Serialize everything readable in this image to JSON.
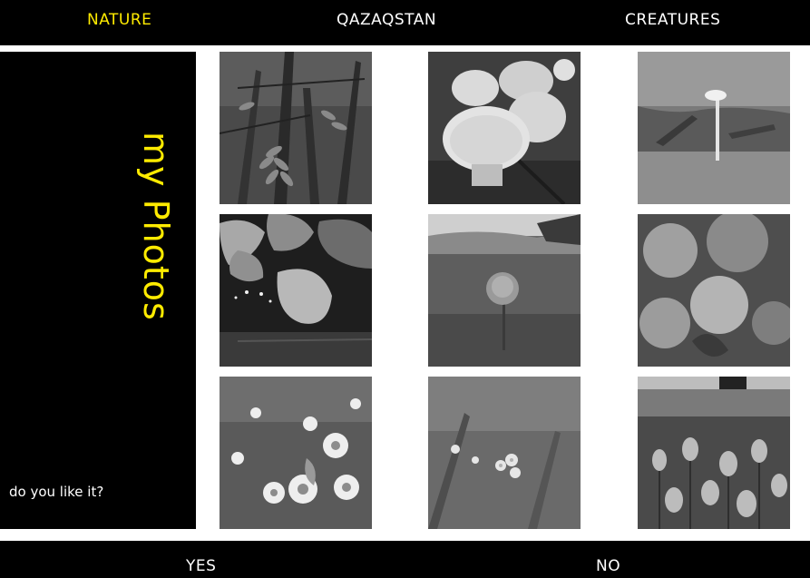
{
  "nav": {
    "items": [
      {
        "label": "NATURE",
        "active": true
      },
      {
        "label": "QAZAQSTAN",
        "active": false
      },
      {
        "label": "CREATURES",
        "active": false
      }
    ]
  },
  "sidebar": {
    "title": "my Photos",
    "question": "do you like it?"
  },
  "gallery": {
    "photos": [
      {
        "subject": "rowan-tree"
      },
      {
        "subject": "puffball-mushrooms"
      },
      {
        "subject": "small-mushroom"
      },
      {
        "subject": "linden-leaves"
      },
      {
        "subject": "globeflower-meadow"
      },
      {
        "subject": "hydrangea"
      },
      {
        "subject": "daisies"
      },
      {
        "subject": "forget-me-nots"
      },
      {
        "subject": "tulip-field"
      }
    ]
  },
  "footer": {
    "yes_label": "YES",
    "no_label": "NO"
  },
  "colors": {
    "accent": "#ffeb00",
    "bar": "#000000",
    "text": "#ffffff"
  }
}
